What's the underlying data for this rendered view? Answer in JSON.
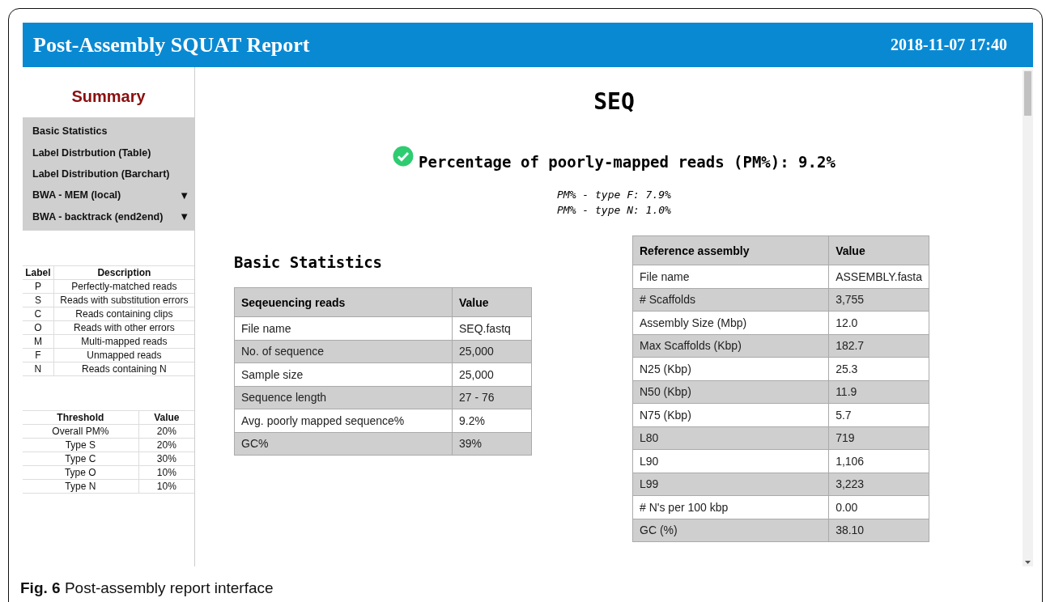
{
  "header": {
    "title": "Post-Assembly SQUAT Report",
    "timestamp": "2018-11-07 17:40"
  },
  "sidebar": {
    "title": "Summary",
    "nav": [
      {
        "label": "Basic Statistics"
      },
      {
        "label": "Label Distrbution (Table)"
      },
      {
        "label": "Label Distribution (Barchart)"
      },
      {
        "label": "BWA - MEM (local)",
        "caret": "▼"
      },
      {
        "label": "BWA - backtrack (end2end)",
        "caret": "▼"
      }
    ],
    "label_table": {
      "columns": [
        "Label",
        "Description"
      ],
      "rows": [
        [
          "P",
          "Perfectly-matched reads"
        ],
        [
          "S",
          "Reads with substitution errors"
        ],
        [
          "C",
          "Reads containing clips"
        ],
        [
          "O",
          "Reads with other errors"
        ],
        [
          "M",
          "Multi-mapped reads"
        ],
        [
          "F",
          "Unmapped reads"
        ],
        [
          "N",
          "Reads containing N"
        ]
      ]
    },
    "threshold_table": {
      "columns": [
        "Threshold",
        "Value"
      ],
      "rows": [
        [
          "Overall PM%",
          "20%"
        ],
        [
          "Type S",
          "20%"
        ],
        [
          "Type C",
          "30%"
        ],
        [
          "Type O",
          "10%"
        ],
        [
          "Type N",
          "10%"
        ]
      ]
    }
  },
  "main": {
    "title": "SEQ",
    "passed": true,
    "pm_headline": "Percentage of poorly-mapped reads (PM%): 9.2%",
    "pm_details": [
      "PM% - type F: 7.9%",
      "PM% - type N: 1.0%"
    ],
    "basic_statistics": {
      "heading": "Basic Statistics",
      "columns": [
        "Seqeuencing reads",
        "Value"
      ],
      "rows": [
        [
          "File name",
          "SEQ.fastq"
        ],
        [
          "No. of sequence",
          "25,000"
        ],
        [
          "Sample size",
          "25,000"
        ],
        [
          "Sequence length",
          "27 - 76"
        ],
        [
          "Avg. poorly mapped sequence%",
          "9.2%"
        ],
        [
          "GC%",
          "39%"
        ]
      ]
    },
    "reference_table": {
      "columns": [
        "Reference assembly",
        "Value"
      ],
      "rows": [
        [
          "File name",
          "ASSEMBLY.fasta"
        ],
        [
          "# Scaffolds",
          "3,755"
        ],
        [
          "Assembly Size (Mbp)",
          "12.0"
        ],
        [
          "Max Scaffolds (Kbp)",
          "182.7"
        ],
        [
          "N25 (Kbp)",
          "25.3"
        ],
        [
          "N50 (Kbp)",
          "11.9"
        ],
        [
          "N75 (Kbp)",
          "5.7"
        ],
        [
          "L80",
          "719"
        ],
        [
          "L90",
          "1,106"
        ],
        [
          "L99",
          "3,223"
        ],
        [
          "# N's per 100 kbp",
          "0.00"
        ],
        [
          "GC (%)",
          "38.10"
        ]
      ]
    }
  },
  "caption": {
    "label": "Fig. 6",
    "text": "Post-assembly report interface"
  }
}
